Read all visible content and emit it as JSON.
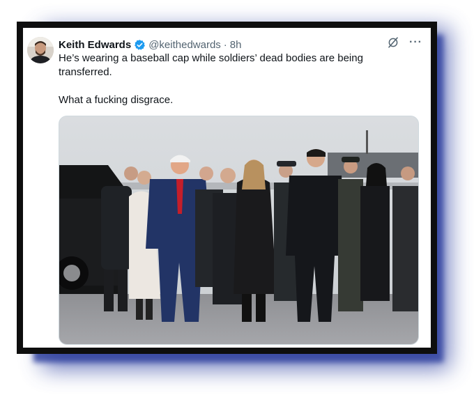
{
  "tweet": {
    "display_name": "Keith Edwards",
    "handle": "@keithedwards",
    "separator": "·",
    "time": "8h",
    "text_line1": "He’s wearing a baseball cap while soldiers’ dead bodies are being transferred.",
    "text_line2": "What a fucking disgrace."
  },
  "icons": {
    "avatar": "avatar",
    "verified": "verified-badge-icon",
    "grok": "grok-icon",
    "more": "more-icon"
  },
  "colors": {
    "verified_blue": "#1d9bf0",
    "frame": "#0e0e0e",
    "shadow": "#3344a0",
    "text_primary": "#0f1419",
    "text_secondary": "#536471"
  },
  "more_symbol": "···"
}
